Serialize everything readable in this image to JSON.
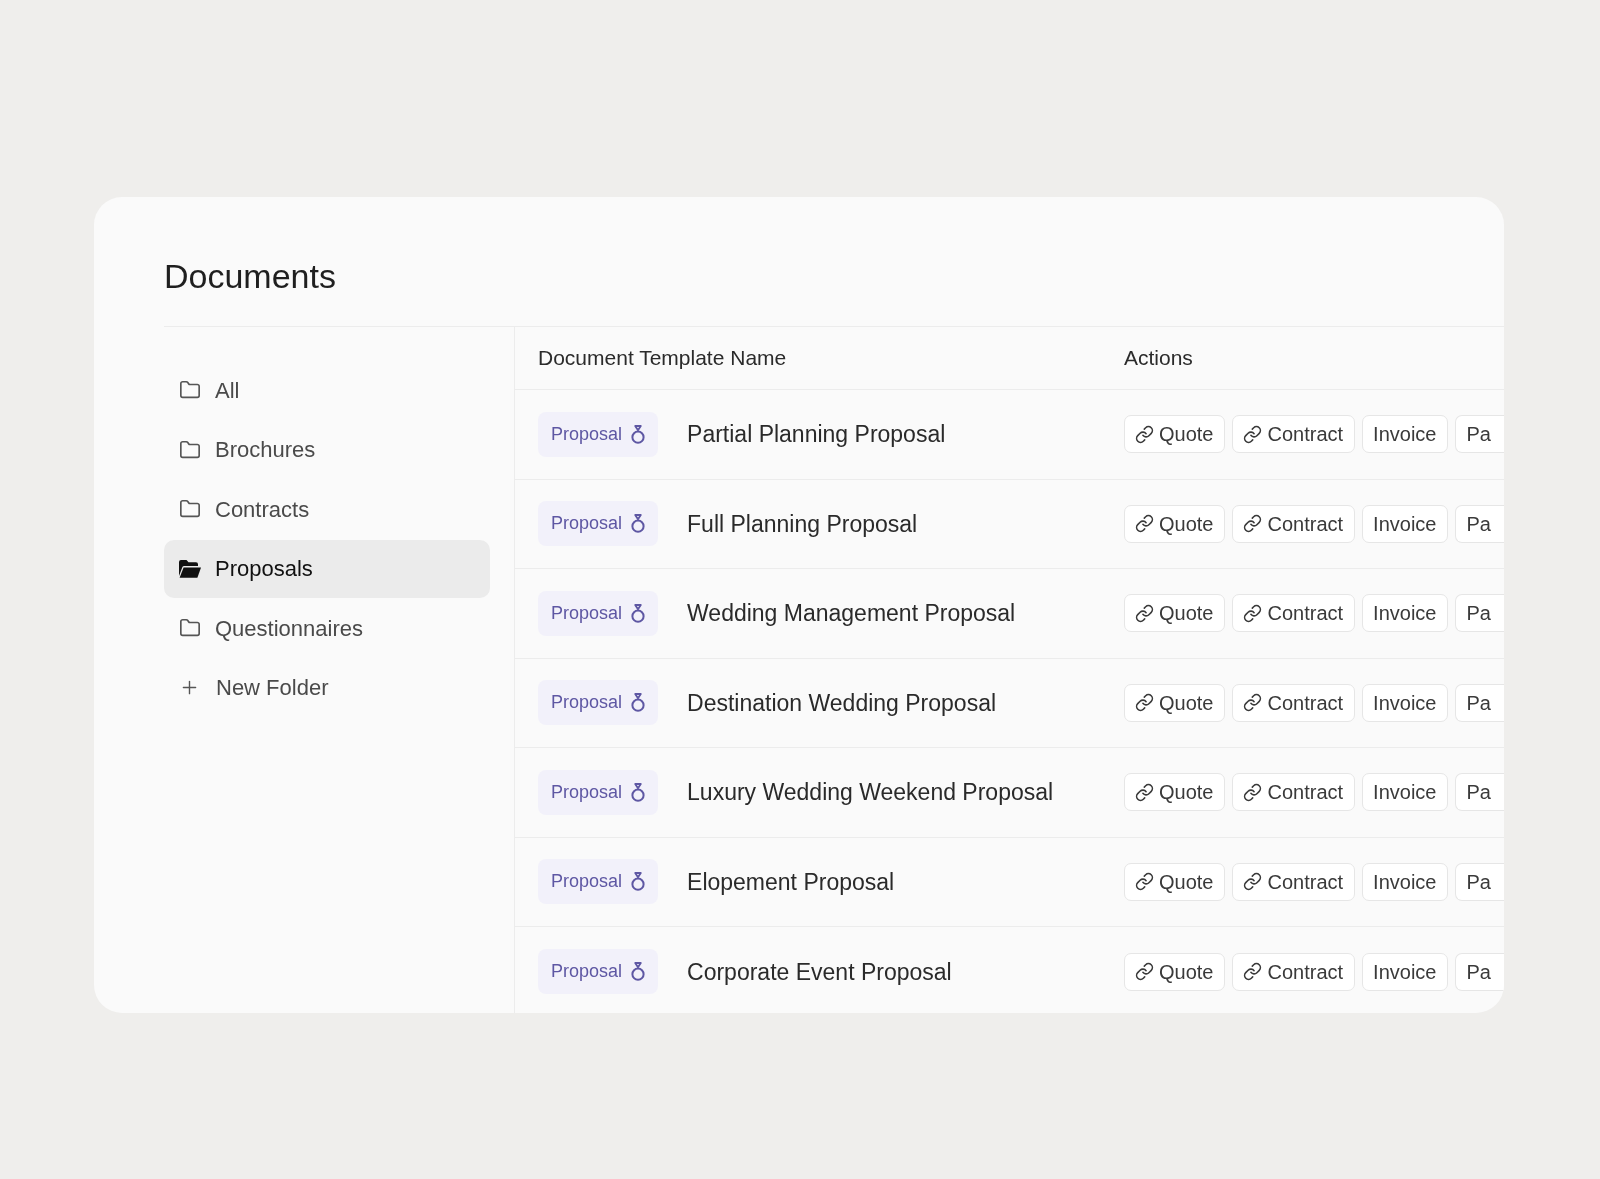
{
  "title": "Documents",
  "folders": [
    {
      "label": "All",
      "selected": false
    },
    {
      "label": "Brochures",
      "selected": false
    },
    {
      "label": "Contracts",
      "selected": false
    },
    {
      "label": "Proposals",
      "selected": true
    },
    {
      "label": "Questionnaires",
      "selected": false
    }
  ],
  "new_folder": {
    "label": "New Folder"
  },
  "table": {
    "columns": [
      "Document Template Name",
      "Actions"
    ],
    "rows": [
      {
        "tag": "Proposal",
        "name": "Partial Planning Proposal",
        "actions": [
          {
            "label": "Quote",
            "linked": true
          },
          {
            "label": "Contract",
            "linked": true
          },
          {
            "label": "Invoice",
            "linked": false
          },
          {
            "label": "Pa",
            "linked": false
          }
        ]
      },
      {
        "tag": "Proposal",
        "name": "Full Planning Proposal",
        "actions": [
          {
            "label": "Quote",
            "linked": true
          },
          {
            "label": "Contract",
            "linked": true
          },
          {
            "label": "Invoice",
            "linked": false
          },
          {
            "label": "Pa",
            "linked": false
          }
        ]
      },
      {
        "tag": "Proposal",
        "name": "Wedding Management Proposal",
        "actions": [
          {
            "label": "Quote",
            "linked": true
          },
          {
            "label": "Contract",
            "linked": true
          },
          {
            "label": "Invoice",
            "linked": false
          },
          {
            "label": "Pa",
            "linked": false
          }
        ]
      },
      {
        "tag": "Proposal",
        "name": "Destination Wedding Proposal",
        "actions": [
          {
            "label": "Quote",
            "linked": true
          },
          {
            "label": "Contract",
            "linked": true
          },
          {
            "label": "Invoice",
            "linked": false
          },
          {
            "label": "Pa",
            "linked": false
          }
        ]
      },
      {
        "tag": "Proposal",
        "name": "Luxury Wedding Weekend Proposal",
        "actions": [
          {
            "label": "Quote",
            "linked": true
          },
          {
            "label": "Contract",
            "linked": true
          },
          {
            "label": "Invoice",
            "linked": false
          },
          {
            "label": "Pa",
            "linked": false
          }
        ]
      },
      {
        "tag": "Proposal",
        "name": "Elopement Proposal",
        "actions": [
          {
            "label": "Quote",
            "linked": true
          },
          {
            "label": "Contract",
            "linked": true
          },
          {
            "label": "Invoice",
            "linked": false
          },
          {
            "label": "Pa",
            "linked": false
          }
        ]
      },
      {
        "tag": "Proposal",
        "name": "Corporate Event Proposal",
        "actions": [
          {
            "label": "Quote",
            "linked": true
          },
          {
            "label": "Contract",
            "linked": true
          },
          {
            "label": "Invoice",
            "linked": false
          },
          {
            "label": "Pa",
            "linked": false
          }
        ]
      }
    ]
  }
}
